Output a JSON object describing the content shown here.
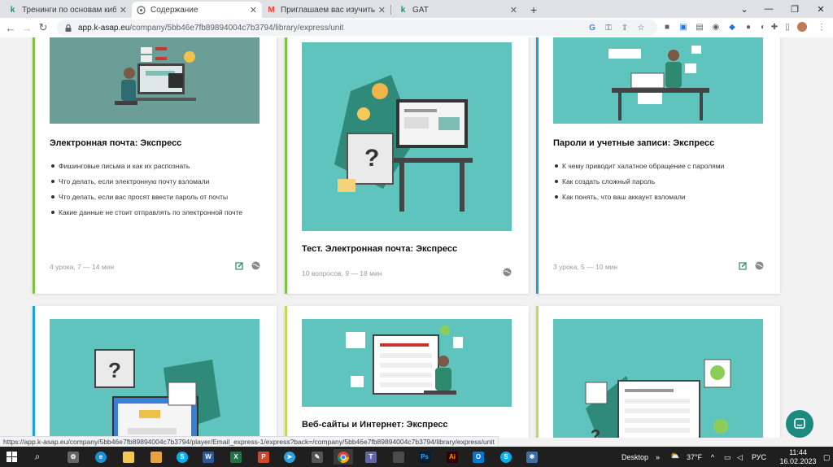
{
  "browser": {
    "tabs": [
      {
        "title": "Тренинги по основам кибербе",
        "icon": "k-logo-icon",
        "active": false
      },
      {
        "title": "Содержание",
        "icon": "page-icon",
        "active": true
      },
      {
        "title": "Приглашаем вас изучить учеб",
        "icon": "gmail-icon",
        "active": false
      },
      {
        "title": "GAT",
        "icon": "k-logo-icon",
        "active": false
      }
    ],
    "new_tab": "+",
    "url_host": "app.k-asap.eu",
    "url_path": "/company/5bb46e7fb89894004c7b3794/library/express/unit",
    "status_url": "https://app.k-asap.eu/company/5bb46e7fb89894004c7b3794/player/Email_express-1/express?back=/company/5bb46e7fb89894004c7b3794/library/express/unit"
  },
  "colors": {
    "teal": "#5ec4bd",
    "green_bar": "#7bc142",
    "blue_bar": "#1aa3d6",
    "yellow_bar": "#c8d65a",
    "chat": "#1d8a80"
  },
  "cards": [
    {
      "title": "Электронная почта: Экспресс",
      "bullets": [
        "Фишинговые письма и как их распознать",
        "Что делать, если электронную почту взломали",
        "Что делать, если вас просят ввести пароль от почты",
        "Какие данные не стоит отправлять по электронной почте"
      ],
      "meta": "4 урока, 7 — 14 мин",
      "bar_color": "#7bc142"
    },
    {
      "title": "Тест. Электронная почта: Экспресс",
      "bullets": [],
      "meta": "10 вопросов, 9 — 18 мин",
      "bar_color": "#7bc142"
    },
    {
      "title": "Пароли и учетные записи: Экспресс",
      "bullets": [
        "К чему приводит халатное обращение с паролями",
        "Как создать сложный пароль",
        "Как понять, что ваш аккаунт взломали"
      ],
      "meta": "3 урока, 5 — 10 мин",
      "bar_color": "#1aa3d6"
    },
    {
      "title": "",
      "bar_color": "#1aa3d6"
    },
    {
      "title": "Веб-сайты и Интернет: Экспресс",
      "bar_color": "#c8d65a"
    },
    {
      "title": "",
      "bar_color": "#c8d65a"
    }
  ],
  "taskbar": {
    "desktop_label": "Desktop",
    "weather": "37°F",
    "lang": "РУС",
    "time": "11:44",
    "date": "16.02.2023"
  }
}
